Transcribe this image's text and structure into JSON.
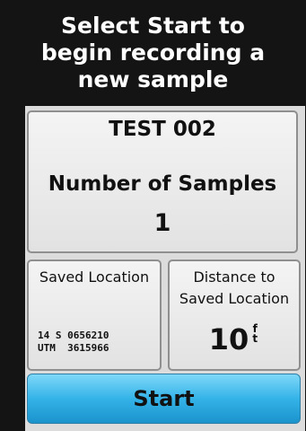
{
  "header": {
    "message": "Select Start to begin recording a new sample"
  },
  "main": {
    "title": "TEST  002",
    "samples_label": "Number of Samples",
    "samples_value": "1"
  },
  "saved_location": {
    "label": "Saved Location",
    "coords": "14 S 0656210\nUTM  3615966"
  },
  "distance": {
    "label": "Distance to Saved Location",
    "value": "10",
    "unit_top": "f",
    "unit_bottom": "t"
  },
  "start_button": {
    "label": "Start"
  },
  "colors": {
    "header_bg": "#141414",
    "button_blue": "#34b3e8",
    "panel_bg": "#eeeeee"
  }
}
